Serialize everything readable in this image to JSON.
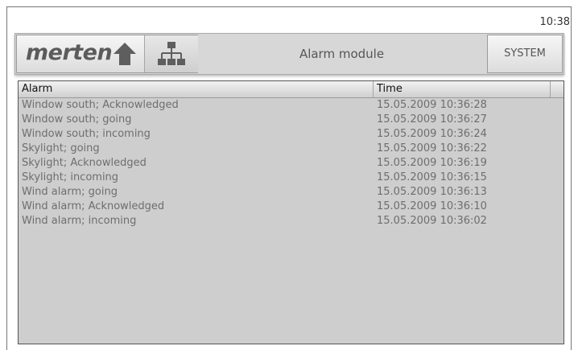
{
  "clock": "10:38",
  "toolbar": {
    "logo": "merten",
    "title": "Alarm module",
    "system_label": "SYSTEM",
    "home_icon": "home-icon",
    "network_icon": "network-icon"
  },
  "table": {
    "headers": [
      "Alarm",
      "Time"
    ],
    "rows": [
      [
        "Window south; Acknowledged",
        "15.05.2009 10:36:28"
      ],
      [
        "Window south; going",
        "15.05.2009 10:36:27"
      ],
      [
        "Window south; incoming",
        "15.05.2009 10:36:24"
      ],
      [
        "Skylight; going",
        "15.05.2009 10:36:22"
      ],
      [
        "Skylight; Acknowledged",
        "15.05.2009 10:36:19"
      ],
      [
        "Skylight; incoming",
        "15.05.2009 10:36:15"
      ],
      [
        "Wind alarm; going",
        "15.05.2009 10:36:13"
      ],
      [
        "Wind alarm; Acknowledged",
        "15.05.2009 10:36:10"
      ],
      [
        "Wind alarm; incoming",
        "15.05.2009 10:36:02"
      ]
    ]
  },
  "colors": {
    "panel": "#cecece",
    "toolbar": "#d7d7d7",
    "text": "#6e6e6e",
    "icon": "#5e5e5e"
  }
}
